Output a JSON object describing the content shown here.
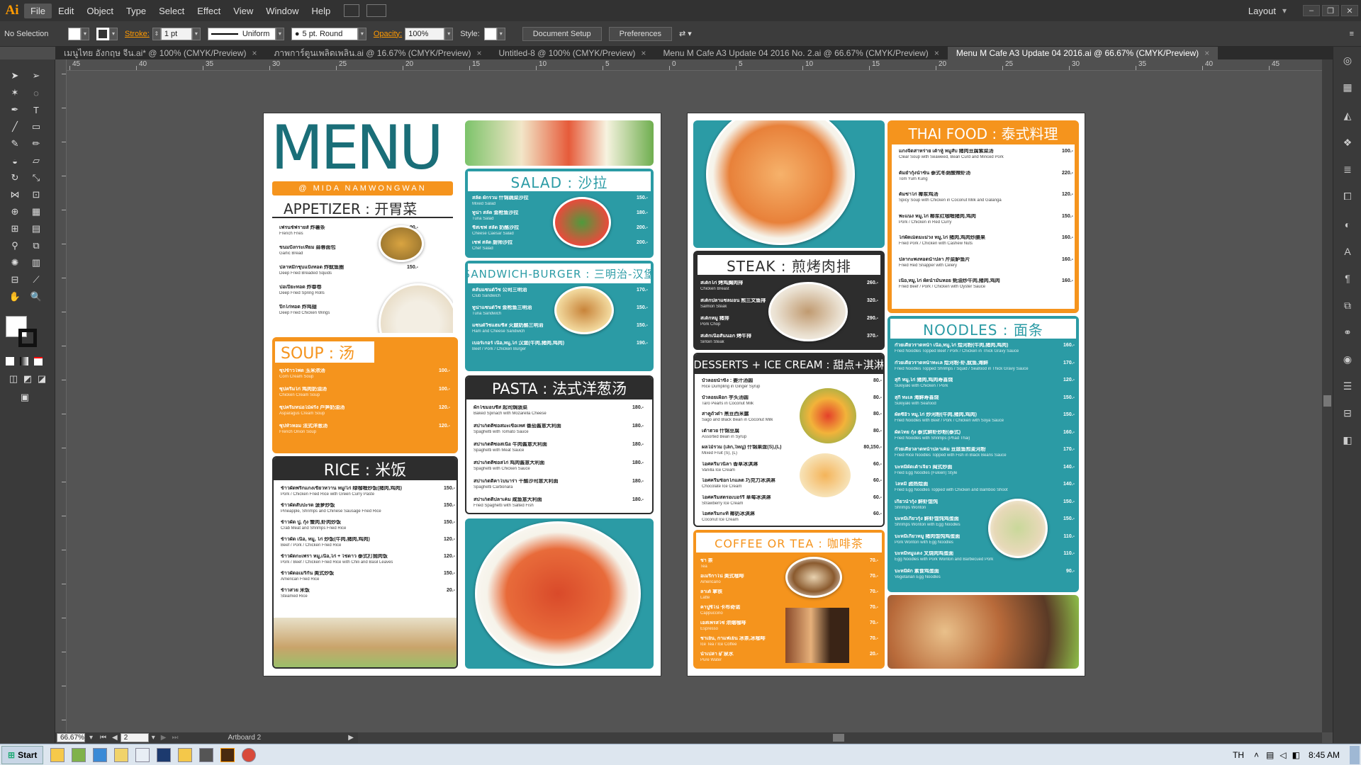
{
  "app": {
    "logo": "Ai",
    "menus": [
      "File",
      "Edit",
      "Object",
      "Type",
      "Select",
      "Effect",
      "View",
      "Window",
      "Help"
    ],
    "workspace": "Layout"
  },
  "control": {
    "selection": "No Selection",
    "stroke_label": "Stroke:",
    "stroke_weight": "1 pt",
    "profile": "Uniform",
    "brush": "5 pt. Round",
    "opacity_label": "Opacity:",
    "opacity": "100%",
    "style_label": "Style:",
    "doc_setup": "Document Setup",
    "preferences": "Preferences"
  },
  "tabs": [
    {
      "label": "เมนูไทย อังกฤษ จีน.ai* @ 100% (CMYK/Preview)",
      "active": false
    },
    {
      "label": "ภาพการ์ตูนเพลิดเพลิน.ai @ 16.67% (CMYK/Preview)",
      "active": false
    },
    {
      "label": "Untitled-8 @ 100% (CMYK/Preview)",
      "active": false
    },
    {
      "label": "Menu M Cafe A3 Update 04 2016 No. 2.ai @ 66.67% (CMYK/Preview)",
      "active": false
    },
    {
      "label": "Menu M Cafe A3 Update 04 2016.ai @ 66.67% (CMYK/Preview)",
      "active": true
    }
  ],
  "ruler": {
    "marks": [
      "45",
      "40",
      "35",
      "30",
      "25",
      "20",
      "15",
      "10",
      "5",
      "0",
      "5",
      "10",
      "15",
      "20",
      "25",
      "30",
      "35",
      "40",
      "45"
    ]
  },
  "status": {
    "zoom": "66.67%",
    "page": "2",
    "artboard": "Artboard 2"
  },
  "taskbar": {
    "start": "Start",
    "lang": "TH",
    "time": "8:45 AM"
  },
  "menu": {
    "brand": "MENU",
    "sub": "@ MIDA NAMWONGWAN",
    "appetizer": {
      "title": "APPETIZER : 开胃菜",
      "items": [
        {
          "n": "เฟรนช์ฟรายส์ 炸薯条",
          "e": "French Fries",
          "p": "90.-"
        },
        {
          "n": "ขนมปังกระเทียม 蒜蓉面包",
          "e": "Garlic Bread",
          "p": "90.-"
        },
        {
          "n": "ปลาหมึกชุบแป้งทอด 炸鱿鱼圈",
          "e": "Deep Fried Breaded Squids",
          "p": "150.-"
        },
        {
          "n": "ปอเปี๊ยะทอด 炸春卷",
          "e": "Deep Fried Spring Rolls",
          "p": "120.-"
        },
        {
          "n": "ปีกไก่ทอด 炸鸡翅",
          "e": "Deep Fried Chicken Wings",
          "p": "170.-"
        }
      ]
    },
    "soup": {
      "title": "SOUP : 汤",
      "items": [
        {
          "n": "ซุปข้าวโพด 玉米浓汤",
          "e": "Corn Cream Soup",
          "p": "100.-"
        },
        {
          "n": "ซุปครีมไก่ 鸡肉奶油汤",
          "e": "Chicken Cream Soup",
          "p": "100.-"
        },
        {
          "n": "ซุปครีมหน่อไม้ฝรั่ง 芦笋奶油汤",
          "e": "Asparagus Cream Soup",
          "p": "120.-"
        },
        {
          "n": "ซุปหัวหอม 法式洋葱汤",
          "e": "French Onion Soup",
          "p": "120.-"
        }
      ]
    },
    "rice": {
      "title": "RICE : 米饭",
      "items": [
        {
          "n": "ข้าวผัดพริกแกงเขียวหวาน หมู/ไก่ 绿咖喱炒饭(猪肉,鸡肉)",
          "e": "Pork / Chicken Fried Rice with Green Curry Paste",
          "p": "150.-"
        },
        {
          "n": "ข้าวผัดสับปะรด 菠萝炒饭",
          "e": "Pineapple, Shrimps and Chinese Sausage Fried Rice",
          "p": "150.-"
        },
        {
          "n": "ข้าวผัด ปู, กุ้ง 蟹肉,虾肉炒饭",
          "e": "Crab Meat and Shrimps Fried Rice",
          "p": "150.-"
        },
        {
          "n": "ข้าวผัด เนื้อ, หมู, ไก่ 炒饭(牛肉,猪肉,鸡肉)",
          "e": "Beef / Pork / Chicken Fried Rice",
          "p": "120.-"
        },
        {
          "n": "ข้าวผัดกะเพรา หมู,เนื้อ,ไก่ + ไข่ดาว 泰式打抛肉饭",
          "e": "Pork / Beef / Chicken Fried Rice with Chili and Basil Leaves",
          "p": "120.-"
        },
        {
          "n": "ข้าวผัดอเมริกัน 美式炒饭",
          "e": "American Fried Rice",
          "p": "150.-"
        },
        {
          "n": "ข้าวสวย 米饭",
          "e": "Steamed Rice",
          "p": "20.-"
        }
      ]
    },
    "salad": {
      "title": "SALAD : 沙拉",
      "items": [
        {
          "n": "สลัด ผักรวม 什锦蔬菜沙拉",
          "e": "Mixed Salad",
          "p": "150.-"
        },
        {
          "n": "ทูน่า สลัด 金枪鱼沙拉",
          "e": "Tuna Salad",
          "p": "180.-"
        },
        {
          "n": "ชีสเชฟ สลัด 奶酪沙拉",
          "e": "Cheese Caesar Salad",
          "p": "200.-"
        },
        {
          "n": "เชฟ สลัด 厨师沙拉",
          "e": "Chef Salad",
          "p": "200.-"
        }
      ]
    },
    "sandwich": {
      "title": "SANDWICH-BURGER : 三明治-汉堡",
      "items": [
        {
          "n": "คลับแซนด์วิช 公司三明治",
          "e": "Club Sandwich",
          "p": "170.-"
        },
        {
          "n": "ทูน่าแซนด์วิช 金枪鱼三明治",
          "e": "Tuna Sandwich",
          "p": "150.-"
        },
        {
          "n": "แซนด์วิชแฮมชีส 火腿奶酪三明治",
          "e": "Ham and Cheese Sandwich",
          "p": "150.-"
        },
        {
          "n": "เบอร์เกอร์ เนื้อ,หมู,ไก่ 汉堡(牛肉,猪肉,鸡肉)",
          "e": "Beef / Pork / Chicken Burger",
          "p": "190.-"
        }
      ]
    },
    "pasta": {
      "title": "PASTA : 法式洋葱汤",
      "items": [
        {
          "n": "ผักโขมอบชีส 起司焗菠菜",
          "e": "Baked Spinach with Mozarella Cheese",
          "p": "180.-"
        },
        {
          "n": "สปาเก็ตตี้ซอสมะเขือเทศ 番茄酱意大利面",
          "e": "Spaghetti with Tomato Sauce",
          "p": "180.-"
        },
        {
          "n": "สปาเก็ตตี้ซอสเนื้อ 牛肉酱意大利面",
          "e": "Spaghetti with Meat Sauce",
          "p": "180.-"
        },
        {
          "n": "สปาเก็ตตี้ซอสไก่ 鸡肉酱意大利面",
          "e": "Spaghetti with Chicken Sauce",
          "p": "180.-"
        },
        {
          "n": "สปาเก็ตตี้คาโบนาร่า 干酪沙司意大利面",
          "e": "Spaghetti Carbonara",
          "p": "180.-"
        },
        {
          "n": "สปาเก็ตตี้ปลาเค็ม 咸鱼意大利面",
          "e": "Fried Spaghetti with Salted Fish",
          "p": "180.-"
        }
      ]
    },
    "thai": {
      "title": "THAI FOOD : 泰式料理",
      "items": [
        {
          "n": "แกงจืดสาหร่าย เต้าหู้ หมูสับ 猪肉豆腐紫菜汤",
          "e": "Clear Soup with Seaweed, Bean Curd and Minced Pork",
          "p": "100.-"
        },
        {
          "n": "ต้มยำกุ้งน้ำข้น 泰式冬荫酸辣虾汤",
          "e": "Tom Yum Kung",
          "p": "220.-"
        },
        {
          "n": "ต้มข่าไก่ 椰浆鸡汤",
          "e": "Spicy Soup with Chicken in Coconut Milk and Galanga",
          "p": "120.-"
        },
        {
          "n": "พะแนง หมู,ไก่ 椰浆红咖喱猪肉,鸡肉",
          "e": "Pork / Chicken in Red Curry",
          "p": "150.-"
        },
        {
          "n": "ไก่ผัดเม็ดมะม่วง หมู,ไก่ 猪肉,鸡肉炒腰果",
          "e": "Fried Pork / Chicken with Cashew Nuts",
          "p": "160.-"
        },
        {
          "n": "ปลากะพงทอดน้ำปลา 芹菜鲈鱼片",
          "e": "Fried Red Snapper with Celery",
          "p": "160.-"
        },
        {
          "n": "เนื้อ,หมู,ไก่ ผัดน้ำมันหอย 蚝油炒牛肉,猪肉,鸡肉",
          "e": "Fried Beef / Pork / Chicken with Oyster Sauce",
          "p": "160.-"
        }
      ]
    },
    "steak": {
      "title": "STEAK : 煎烤肉排",
      "items": [
        {
          "n": "สเต็กไก่ 烤鸡胸肉排",
          "e": "Chicken Breast",
          "p": "260.-"
        },
        {
          "n": "สเต็กปลาแซลมอน 煎三文鱼排",
          "e": "Salmon Steak",
          "p": "320.-"
        },
        {
          "n": "สเต็กหมู 猪排",
          "e": "Pork Chop",
          "p": "290.-"
        },
        {
          "n": "สเต็กเนื้อสันนอก 烤牛排",
          "e": "Sirloin Steak",
          "p": "370.-"
        }
      ]
    },
    "desserts": {
      "title": "DESSERTS + ICE CREAM : 甜点+淇淋",
      "items": [
        {
          "n": "บัวลอยน้ำขิง : 姜汁汤圆",
          "e": "Rice Dumpling in Ginger Syrup",
          "p": "80.-"
        },
        {
          "n": "บัวลอยเผือก 芋头汤圆",
          "e": "Taro Pearls in Coconut Milk",
          "p": "80.-"
        },
        {
          "n": "สาคูถั่วดำ 黑豆西米露",
          "e": "Sago and Black Bean in Coconut Milk",
          "p": "80.-"
        },
        {
          "n": "เต้าฮวย 什锦豆腐",
          "e": "Assorted Bean in Syrup",
          "p": "80.-"
        },
        {
          "n": "ผลไม้รวม (เล็ก,ใหญ่) 什锦果盘(S),(L)",
          "e": "Mixed Fruit (S), (L)",
          "p": "80,150.-"
        },
        {
          "n": "ไอศครีมวนิลา 香草冰淇淋",
          "e": "Vanilla Ice Cream",
          "p": "60.-"
        },
        {
          "n": "ไอศครีมช็อกโกแลต 巧克力冰淇淋",
          "e": "Chocolate Ice Cream",
          "p": "60.-"
        },
        {
          "n": "ไอศครีมสตรอเบอร์รี่ 草莓冰淇淋",
          "e": "Strawberry Ice Cream",
          "p": "60.-"
        },
        {
          "n": "ไอศครีมกะทิ 椰奶冰淇淋",
          "e": "Coconut Ice Cream",
          "p": "60.-"
        }
      ]
    },
    "coffee": {
      "title": "COFFEE OR TEA : 咖啡茶",
      "items": [
        {
          "n": "ชา 茶",
          "e": "Tea",
          "p": "70.-"
        },
        {
          "n": "อเมริกาโน่ 美式咖啡",
          "e": "Americano",
          "p": "70.-"
        },
        {
          "n": "ลาเต้ 拿铁",
          "e": "Latte",
          "p": "70.-"
        },
        {
          "n": "คาปูชิโน่ 卡布奇诺",
          "e": "Cappuccino",
          "p": "70.-"
        },
        {
          "n": "เอสเพรสโซ่ 浓缩咖啡",
          "e": "Espresso",
          "p": "70.-"
        },
        {
          "n": "ชาเย็น, กาแฟเย็น 冰茶,冰咖啡",
          "e": "Ice Tea / Ice Coffee",
          "p": "70.-"
        },
        {
          "n": "น้ำเปล่า 矿泉水",
          "e": "Pure Water",
          "p": "20.-"
        }
      ]
    },
    "noodles": {
      "title": "NOODLES : 面条",
      "items": [
        {
          "n": "ก๋วยเตี๋ยวราดหน้า เนื้อ,หมู,ไก่ 烩河粉(牛肉,猪肉,鸡肉)",
          "e": "Fried Noodles Topped Beef / Pork / Chicken in Thick Gravy Sauce",
          "p": "160.-"
        },
        {
          "n": "ก๋วยเตี๋ยวราดหน้าทะเล 烩河粉-虾,鱿鱼,海鲜",
          "e": "Fried Noodles Topped Shrimps / Squid / Seafood in Thick Gravy Sauce",
          "p": "170.-"
        },
        {
          "n": "สุกี้ หมู,ไก่ 猪肉,鸡肉寿喜烧",
          "e": "Sukiyaki with Chicken / Pork",
          "p": "120.-"
        },
        {
          "n": "สุกี้ ทะเล 海鲜寿喜烧",
          "e": "Sukiyaki with Seafood",
          "p": "150.-"
        },
        {
          "n": "ผัดซีอิ๊ว หมู,ไก่ 炒河粉(牛肉,猪肉,鸡肉)",
          "e": "Fried Noodles with Beef / Pork / Chicken with Soya Sauce",
          "p": "150.-"
        },
        {
          "n": "ผัดไทย กุ้ง 泰式鲜虾炒粉(泰式)",
          "e": "Fried Noodles with Shrimps (Phad Thai)",
          "p": "160.-"
        },
        {
          "n": "ก๋วยเตี๋ยวลาดหน้าปลาเค็ม 豆豉鱼煎麦河粉",
          "e": "Fried Rice Noodles Topped with Fish in Black Beans Sauce",
          "p": "170.-"
        },
        {
          "n": "บะหมี่ผัดเต้าเจี้ยว 闽式炒面",
          "e": "Fried Egg Noodles (Fukien) Style",
          "p": "140.-"
        },
        {
          "n": "โลหมี่ 卤热烩面",
          "e": "Fried Egg Noodles Topped with Chicken and Bamboo Shoot",
          "p": "140.-"
        },
        {
          "n": "เกี๊ยวน้ำกุ้ง 鲜虾馄饨",
          "e": "Shrimps Wonton",
          "p": "150.-"
        },
        {
          "n": "บะหมี่เกี๊ยวกุ้ง 鲜虾馄饨鸡蛋面",
          "e": "Shrimps Wonton with Egg Noodles",
          "p": "150.-"
        },
        {
          "n": "บะหมี่เกี๊ยวหมู 猪肉馄饨鸡蛋面",
          "e": "Pork Wonton with Egg Noodles",
          "p": "110.-"
        },
        {
          "n": "บะหมี่หมูแดง 叉烧肉鸡蛋面",
          "e": "Egg Noodles with Pork Wonton and Barbecued Pork",
          "p": "110.-"
        },
        {
          "n": "บะหมี่ผัก 素食鸡蛋面",
          "e": "Vegetarian Egg Noodles",
          "p": "90.-"
        }
      ]
    }
  },
  "colors": {
    "teal": "#2b9ba5",
    "orange": "#f5941d",
    "dark": "#2d2d2d",
    "brand": "#1a6e78",
    "ai_orange": "#ff9a00"
  }
}
